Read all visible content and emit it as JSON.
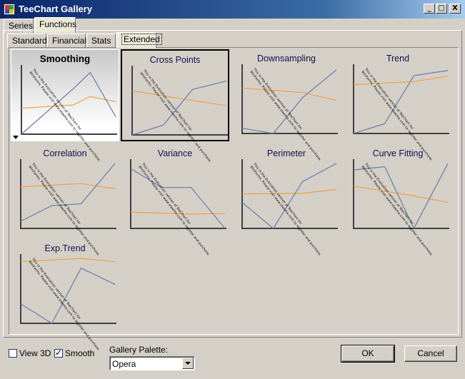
{
  "window": {
    "title": "TeeChart Gallery",
    "minimize": "_",
    "maximize": "□",
    "close": "X"
  },
  "outer_tabs": [
    {
      "label": "Series",
      "active": false
    },
    {
      "label": "Functions",
      "active": true
    }
  ],
  "inner_tabs": [
    {
      "label": "Standard",
      "active": false
    },
    {
      "label": "Financial",
      "active": false
    },
    {
      "label": "Stats",
      "active": false
    },
    {
      "label": "Extended",
      "active": true
    }
  ],
  "watermark": "This is the Evaluation version of TeeChart for WinForms. Please visit www.steema.com to register and purchase.",
  "gallery": [
    {
      "title": "Smoothing",
      "blue": [
        [
          0,
          1.0
        ],
        [
          0.55,
          0.3
        ],
        [
          0.73,
          0.05
        ],
        [
          1,
          0.73
        ]
      ],
      "orange": [
        [
          0,
          0.6
        ],
        [
          0.55,
          0.55
        ],
        [
          0.73,
          0.42
        ],
        [
          1,
          0.5
        ]
      ]
    },
    {
      "title": "Cross Points",
      "blue": [
        [
          0,
          1.0
        ],
        [
          0.33,
          0.85
        ],
        [
          0.64,
          0.3
        ],
        [
          1,
          0.17
        ]
      ],
      "orange": [
        [
          0,
          0.32
        ],
        [
          0.64,
          0.47
        ],
        [
          1,
          0.55
        ]
      ]
    },
    {
      "title": "Downsampling",
      "blue": [
        [
          0,
          0.92
        ],
        [
          0.33,
          1.0
        ],
        [
          0.64,
          0.45
        ],
        [
          1,
          0.02
        ]
      ],
      "orange": [
        [
          0,
          0.3
        ],
        [
          0.64,
          0.37
        ],
        [
          1,
          0.49
        ]
      ]
    },
    {
      "title": "Trend",
      "blue": [
        [
          0,
          1.0
        ],
        [
          0.33,
          0.85
        ],
        [
          0.64,
          0.11
        ],
        [
          1,
          0.03
        ]
      ],
      "orange": [
        [
          0,
          0.25
        ],
        [
          0.64,
          0.2
        ],
        [
          1,
          0.12
        ]
      ]
    },
    {
      "title": "Correlation",
      "blue": [
        [
          0,
          0.89
        ],
        [
          0.33,
          0.65
        ],
        [
          0.64,
          0.62
        ],
        [
          1,
          0.0
        ]
      ],
      "orange": [
        [
          0,
          0.36
        ],
        [
          0.64,
          0.31
        ],
        [
          1,
          0.39
        ]
      ]
    },
    {
      "title": "Variance",
      "blue": [
        [
          0,
          0.08
        ],
        [
          0.33,
          0.37
        ],
        [
          0.64,
          0.37
        ],
        [
          1,
          1.0
        ]
      ],
      "orange": [
        [
          0,
          0.75
        ],
        [
          0.64,
          0.78
        ],
        [
          1,
          0.77
        ]
      ]
    },
    {
      "title": "Perimeter",
      "blue": [
        [
          0,
          0.6
        ],
        [
          0.33,
          1.0
        ],
        [
          0.64,
          0.28
        ],
        [
          1,
          0.0
        ]
      ],
      "orange": [
        [
          0,
          0.47
        ],
        [
          0.64,
          0.46
        ],
        [
          1,
          0.4
        ]
      ]
    },
    {
      "title": "Curve Fitting",
      "blue": [
        [
          0,
          0.1
        ],
        [
          0.33,
          0.05
        ],
        [
          0.64,
          1.0
        ],
        [
          1,
          0.0
        ]
      ],
      "orange": [
        [
          0,
          0.35
        ],
        [
          0.64,
          0.5
        ],
        [
          1,
          0.6
        ]
      ]
    },
    {
      "title": "Exp.Trend",
      "blue": [
        [
          0,
          0.7
        ],
        [
          0.33,
          1.0
        ],
        [
          0.64,
          0.15
        ],
        [
          1,
          0.4
        ]
      ],
      "orange": [
        [
          0,
          0.05
        ],
        [
          0.64,
          0.0
        ],
        [
          1,
          0.05
        ]
      ]
    }
  ],
  "colors": {
    "blue": "#6a7ba6",
    "orange": "#f0a040",
    "axis": "#404040"
  },
  "options": {
    "view3d_label": "View 3D",
    "view3d_checked": false,
    "smooth_label": "Smooth",
    "smooth_checked": true,
    "palette_label": "Gallery Palette:",
    "palette_value": "Opera"
  },
  "buttons": {
    "ok": "OK",
    "cancel": "Cancel"
  }
}
